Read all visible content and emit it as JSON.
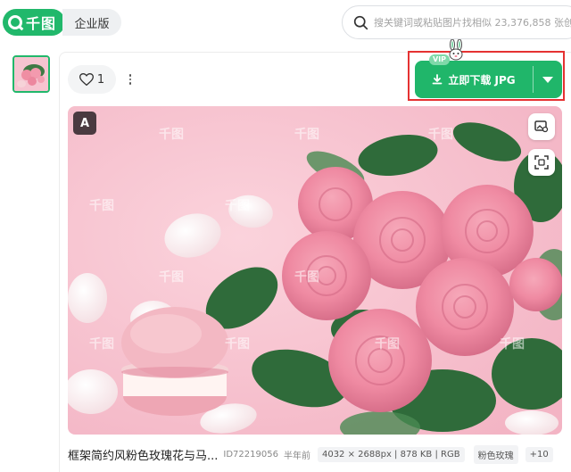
{
  "header": {
    "logo_text": "千图",
    "enterprise_label": "企业版",
    "search_placeholder": "搜关键词或粘贴图片找相似 23,376,858 张创"
  },
  "actions": {
    "like_count": "1",
    "download_label": "立即下载 JPG",
    "vip_badge": "VIP"
  },
  "image": {
    "ai_badge": "A",
    "watermark": "千图"
  },
  "info": {
    "title": "框架简约风粉色玫瑰花与马...",
    "id": "ID72219056",
    "age": "半年前",
    "specs": "4032 × 2688px | 878 KB | RGB",
    "tag": "粉色玫瑰",
    "more_tags": "+10"
  },
  "colors": {
    "brand_green": "#21b86b",
    "highlight_red": "#e53232",
    "background_pink": "#f7c3cf"
  }
}
